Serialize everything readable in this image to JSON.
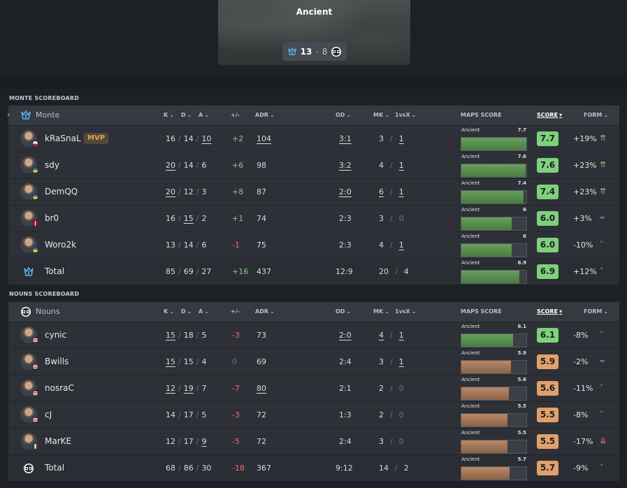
{
  "map": {
    "name": "Ancient",
    "score_left": "13",
    "score_sep": "-",
    "score_right": "8"
  },
  "colors": {
    "good": "#7ed17b",
    "bad": "#e1a06a",
    "positive": "#7fd27a",
    "negative": "#ff6b6b"
  },
  "headers": {
    "k": "K",
    "d": "D",
    "a": "A",
    "pm": "+/-",
    "adr": "ADR",
    "od": "OD",
    "mk": "MK",
    "vsx": "1vsX",
    "maps": "MAPS SCORE",
    "score": "SCORE",
    "form": "FORM"
  },
  "monte": {
    "section_title": "MONTE SCOREBOARD",
    "team_name": "Monte",
    "players": [
      {
        "name": "kRaSnaL",
        "mvp": "MVP",
        "k": "16",
        "d": "14",
        "a": "10",
        "pm": "+2",
        "adr": "104",
        "od": "3:1",
        "mk": "3",
        "vsx": "1",
        "map": "Ancient",
        "map_score": "7.7",
        "score": "7.7",
        "form": "+19%",
        "flag": "pl",
        "trend": "double-up"
      },
      {
        "name": "sdy",
        "k": "20",
        "d": "14",
        "a": "6",
        "pm": "+6",
        "adr": "98",
        "od": "3:2",
        "mk": "4",
        "vsx": "1",
        "map": "Ancient",
        "map_score": "7.6",
        "score": "7.6",
        "form": "+23%",
        "flag": "ua",
        "trend": "double-up"
      },
      {
        "name": "DemQQ",
        "k": "20",
        "d": "12",
        "a": "3",
        "pm": "+8",
        "adr": "87",
        "od": "2:0",
        "mk": "6",
        "vsx": "1",
        "map": "Ancient",
        "map_score": "7.4",
        "score": "7.4",
        "form": "+23%",
        "flag": "ua",
        "trend": "double-up"
      },
      {
        "name": "br0",
        "k": "16",
        "d": "15",
        "a": "2",
        "pm": "+1",
        "adr": "74",
        "od": "2:3",
        "mk": "3",
        "vsx": "0",
        "map": "Ancient",
        "map_score": "6",
        "score": "6.0",
        "form": "+3%",
        "flag": "dk",
        "trend": "flat"
      },
      {
        "name": "Woro2k",
        "k": "13",
        "d": "14",
        "a": "6",
        "pm": "-1",
        "adr": "75",
        "od": "2:3",
        "mk": "4",
        "vsx": "1",
        "map": "Ancient",
        "map_score": "6",
        "score": "6.0",
        "form": "-10%",
        "flag": "ua",
        "trend": "down"
      }
    ],
    "total": {
      "name": "Total",
      "k": "85",
      "d": "69",
      "a": "27",
      "pm": "+16",
      "adr": "437",
      "od": "12:9",
      "mk": "20",
      "vsx": "4",
      "map": "Ancient",
      "map_score": "6.9",
      "score": "6.9",
      "form": "+12%",
      "trend": "up"
    }
  },
  "nouns": {
    "section_title": "NOUNS SCOREBOARD",
    "team_name": "Nouns",
    "players": [
      {
        "name": "cynic",
        "k": "15",
        "d": "18",
        "a": "5",
        "pm": "-3",
        "adr": "73",
        "od": "2:0",
        "mk": "4",
        "vsx": "1",
        "map": "Ancient",
        "map_score": "6.1",
        "score": "6.1",
        "form": "-8%",
        "flag": "us",
        "trend": "down"
      },
      {
        "name": "Bwills",
        "k": "15",
        "d": "15",
        "a": "4",
        "pm": "0",
        "adr": "69",
        "od": "2:4",
        "mk": "3",
        "vsx": "1",
        "map": "Ancient",
        "map_score": "5.9",
        "score": "5.9",
        "form": "-2%",
        "flag": "us",
        "trend": "flat"
      },
      {
        "name": "nosraC",
        "k": "12",
        "d": "19",
        "a": "7",
        "pm": "-7",
        "adr": "80",
        "od": "2:1",
        "mk": "2",
        "vsx": "0",
        "map": "Ancient",
        "map_score": "5.6",
        "score": "5.6",
        "form": "-11%",
        "flag": "us",
        "trend": "down"
      },
      {
        "name": "cJ",
        "k": "14",
        "d": "17",
        "a": "5",
        "pm": "-3",
        "adr": "72",
        "od": "1:3",
        "mk": "2",
        "vsx": "0",
        "map": "Ancient",
        "map_score": "5.5",
        "score": "5.5",
        "form": "-8%",
        "flag": "us",
        "trend": "down"
      },
      {
        "name": "MarKE",
        "k": "12",
        "d": "17",
        "a": "9",
        "pm": "-5",
        "adr": "72",
        "od": "2:4",
        "mk": "3",
        "vsx": "0",
        "map": "Ancient",
        "map_score": "5.5",
        "score": "5.5",
        "form": "-17%",
        "flag": "mx",
        "trend": "double-down"
      }
    ],
    "total": {
      "name": "Total",
      "k": "68",
      "d": "86",
      "a": "30",
      "pm": "-18",
      "adr": "367",
      "od": "9:12",
      "mk": "14",
      "vsx": "2",
      "map": "Ancient",
      "map_score": "5.7",
      "score": "5.7",
      "form": "-9%",
      "trend": "down"
    }
  }
}
